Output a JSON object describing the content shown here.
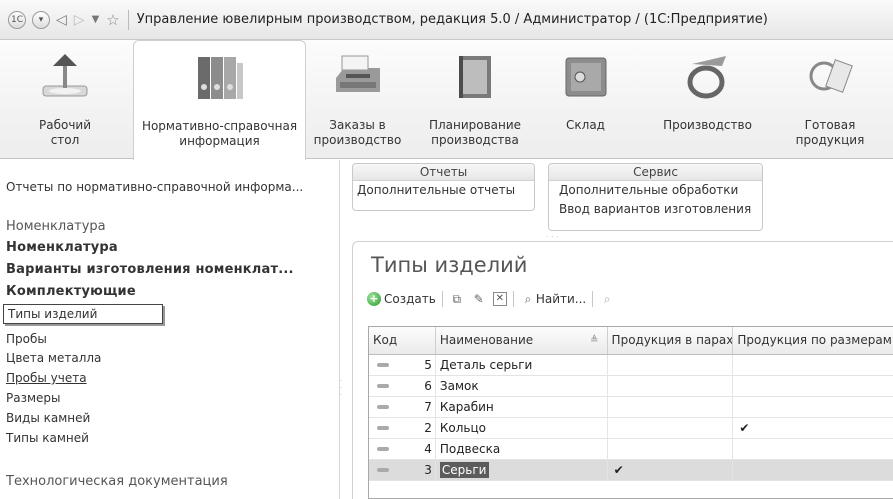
{
  "window": {
    "title": "Управление ювелирным производством, редакция 5.0 / Администратор / (1С:Предприятие)"
  },
  "sections": [
    {
      "label": "Рабочий\nстол",
      "icon": "desk-lamp-icon"
    },
    {
      "label": "Нормативно-справочная\nинформация",
      "icon": "binders-icon",
      "active": true
    },
    {
      "label": "Заказы в\nпроизводство",
      "icon": "fax-icon"
    },
    {
      "label": "Планирование\nпроизводства",
      "icon": "planner-book-icon"
    },
    {
      "label": "Склад",
      "icon": "safe-icon"
    },
    {
      "label": "Производство",
      "icon": "ring-icon"
    },
    {
      "label": "Готовая\nпродукция",
      "icon": "jewelry-tag-icon"
    }
  ],
  "leftnav": {
    "reports_link": "Отчеты по нормативно-справочной информа...",
    "group_nomenclature": "Номенклатура",
    "items": [
      {
        "label": "Номенклатура",
        "style": "bold"
      },
      {
        "label": "Варианты изготовления номенклат...",
        "style": "bold"
      },
      {
        "label": "Комплектующие",
        "style": "bold"
      },
      {
        "label": "Типы изделий",
        "style": "selected"
      },
      {
        "label": "Пробы",
        "style": "normal"
      },
      {
        "label": "Цвета металла",
        "style": "normal"
      },
      {
        "label": "Пробы учета",
        "style": "link"
      },
      {
        "label": "Размеры",
        "style": "normal"
      },
      {
        "label": "Виды камней",
        "style": "normal"
      },
      {
        "label": "Типы камней",
        "style": "normal"
      }
    ],
    "group_tech": "Технологическая документация"
  },
  "commands": {
    "reports": {
      "title": "Отчеты",
      "items": [
        "Дополнительные отчеты"
      ]
    },
    "service": {
      "title": "Сервис",
      "items": [
        "Дополнительные обработки",
        "Ввод вариантов изготовления"
      ]
    }
  },
  "form": {
    "title": "Типы изделий",
    "toolbar": {
      "create": "Создать",
      "find": "Найти..."
    },
    "columns": [
      "Код",
      "Наименование",
      "Продукция в парах",
      "Продукция по размерам"
    ],
    "rows": [
      {
        "code": "5",
        "name": "Деталь серьги",
        "pairs": "",
        "sizes": ""
      },
      {
        "code": "6",
        "name": "Замок",
        "pairs": "",
        "sizes": ""
      },
      {
        "code": "7",
        "name": "Карабин",
        "pairs": "",
        "sizes": ""
      },
      {
        "code": "2",
        "name": "Кольцо",
        "pairs": "",
        "sizes": "✔"
      },
      {
        "code": "4",
        "name": "Подвеска",
        "pairs": "",
        "sizes": ""
      },
      {
        "code": "3",
        "name": "Серьги",
        "pairs": "✔",
        "sizes": "",
        "selected": true
      }
    ]
  }
}
